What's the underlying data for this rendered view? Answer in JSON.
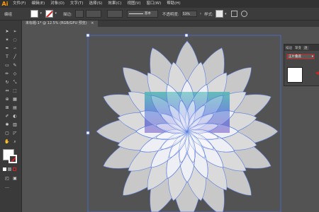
{
  "app": {
    "logo": "Ai"
  },
  "menu": [
    "文件(F)",
    "编辑(E)",
    "对象(O)",
    "文字(T)",
    "选择(S)",
    "效果(C)",
    "视图(V)",
    "窗口(W)",
    "帮助(H)"
  ],
  "control_bar": {
    "selection_label": "编组",
    "stroke_label": "描边:",
    "stroke_style": "基本",
    "opacity_label": "不透明度:",
    "opacity_value": "53%",
    "style_label": "样式:"
  },
  "document_tab": {
    "title": "未标题-1* @ 12.5% (RGB/GPU 预览)",
    "close": "×"
  },
  "panel": {
    "tabs": [
      "描边",
      "渐变",
      "透"
    ],
    "blend_mode": "正片叠底",
    "blend_arrow": "▾",
    "arrow_icon": "◀"
  },
  "colors": {
    "petal_fill": "#c8c8c8",
    "petal_stroke": "#5b7de0",
    "selection": "#4a6de0"
  }
}
